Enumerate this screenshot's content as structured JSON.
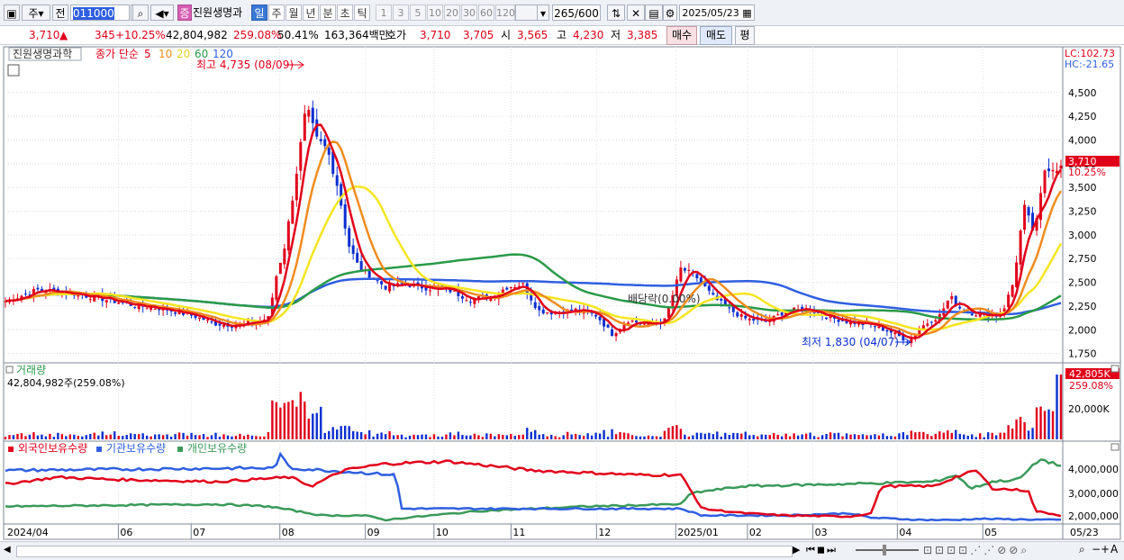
{
  "toolbar": {
    "market_label": "주",
    "type_label": "전",
    "code": "011000",
    "stock_badge": "증",
    "stock_name": "진원생명과학",
    "periods": [
      "일",
      "주",
      "월",
      "년",
      "분",
      "초",
      "틱"
    ],
    "active_period": "일",
    "intervals": [
      "1",
      "3",
      "5",
      "10",
      "20",
      "30",
      "60",
      "120"
    ],
    "count": "265",
    "count_total": "/600",
    "date": "2025/05/23"
  },
  "quote": {
    "price": "3,710",
    "arrow": "▲",
    "change": "345",
    "change_pct": "+10.25%",
    "volume": "42,804,982",
    "volume_ratio": "259.08%",
    "turnover": "50.41%",
    "amount": "163,364백만",
    "ask_label": "호가",
    "ask1": "3,710",
    "ask2": "3,705",
    "open_label": "시",
    "open": "3,565",
    "high_label": "고",
    "high": "4,230",
    "low_label": "저",
    "low": "3,385",
    "buy_label": "매수",
    "sell_label": "매도",
    "avg_label": "평"
  },
  "colors": {
    "up": "#e1001a",
    "down": "#0a2fd0",
    "ma5": "#e1001a",
    "ma10": "#f08c1e",
    "ma20": "#f5e51e",
    "ma60": "#2a9a48",
    "ma120": "#2f5fe0",
    "foreign": "#e1001a",
    "institution": "#2f5fe0",
    "individual": "#3a9a5a"
  },
  "chart_data": [
    {
      "type": "candlestick",
      "title": "진원생명과학",
      "legend": [
        "종가 단순",
        "5",
        "10",
        "20",
        "60",
        "120"
      ],
      "y_ticks": [
        1750,
        2000,
        2250,
        2500,
        2750,
        3000,
        3250,
        3500,
        3750,
        4000,
        4250,
        4500
      ],
      "ylim": [
        1680,
        4830
      ],
      "lc": "LC:102.73",
      "hc": "HC:-21.65",
      "last_price": "3,710",
      "last_change": "10.25%",
      "annotations": {
        "high": "최고 4,735 (08/09)",
        "low": "최저 1,830 (04/07)",
        "dividend": "배당락(0.00%)"
      },
      "x_labels": [
        "2024/04",
        "06",
        "07",
        "08",
        "09",
        "10",
        "11",
        "12",
        "2025/01",
        "02",
        "03",
        "04",
        "05",
        "05/23"
      ],
      "close_path_points": [
        [
          0,
          2300
        ],
        [
          0.03,
          2420
        ],
        [
          0.06,
          2390
        ],
        [
          0.09,
          2330
        ],
        [
          0.12,
          2260
        ],
        [
          0.15,
          2220
        ],
        [
          0.18,
          2140
        ],
        [
          0.2,
          2060
        ],
        [
          0.22,
          2050
        ],
        [
          0.24,
          2090
        ],
        [
          0.25,
          2130
        ],
        [
          0.255,
          2500
        ],
        [
          0.265,
          2900
        ],
        [
          0.275,
          3600
        ],
        [
          0.285,
          4350
        ],
        [
          0.295,
          4000
        ],
        [
          0.305,
          3900
        ],
        [
          0.315,
          3500
        ],
        [
          0.325,
          2900
        ],
        [
          0.335,
          2650
        ],
        [
          0.345,
          2580
        ],
        [
          0.36,
          2450
        ],
        [
          0.38,
          2480
        ],
        [
          0.4,
          2440
        ],
        [
          0.42,
          2420
        ],
        [
          0.44,
          2320
        ],
        [
          0.46,
          2350
        ],
        [
          0.475,
          2450
        ],
        [
          0.49,
          2480
        ],
        [
          0.505,
          2200
        ],
        [
          0.52,
          2180
        ],
        [
          0.54,
          2210
        ],
        [
          0.56,
          2150
        ],
        [
          0.575,
          1950
        ],
        [
          0.59,
          2100
        ],
        [
          0.61,
          2050
        ],
        [
          0.625,
          2100
        ],
        [
          0.64,
          2650
        ],
        [
          0.655,
          2550
        ],
        [
          0.67,
          2350
        ],
        [
          0.685,
          2220
        ],
        [
          0.7,
          2120
        ],
        [
          0.72,
          2080
        ],
        [
          0.74,
          2200
        ],
        [
          0.76,
          2220
        ],
        [
          0.78,
          2130
        ],
        [
          0.8,
          2080
        ],
        [
          0.82,
          2050
        ],
        [
          0.84,
          1970
        ],
        [
          0.855,
          1880
        ],
        [
          0.87,
          2050
        ],
        [
          0.885,
          2150
        ],
        [
          0.895,
          2350
        ],
        [
          0.905,
          2220
        ],
        [
          0.915,
          2180
        ],
        [
          0.93,
          2150
        ],
        [
          0.94,
          2150
        ],
        [
          0.945,
          2200
        ],
        [
          0.955,
          2500
        ],
        [
          0.965,
          3300
        ],
        [
          0.975,
          3000
        ],
        [
          0.985,
          3710
        ]
      ]
    },
    {
      "type": "bar",
      "title": "거래량",
      "current": "42,804,982주(259.08%)",
      "last_label": "42,805K",
      "last_pct": "259.08%",
      "y_ticks": [
        "20,000K"
      ]
    },
    {
      "type": "line",
      "legend": [
        "외국인보유수량",
        "기관보유수량",
        "개인보유수량"
      ],
      "y_ticks": [
        "4,000,000",
        "3,000,000",
        "2,000,000"
      ]
    }
  ]
}
